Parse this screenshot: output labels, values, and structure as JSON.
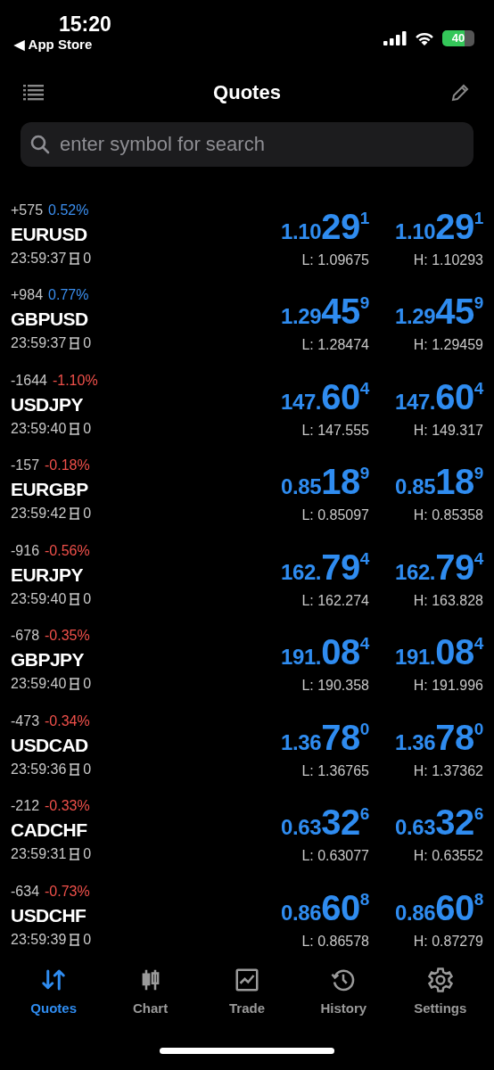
{
  "status_bar": {
    "time": "15:20",
    "back_label": "◀ App Store",
    "battery": "40"
  },
  "header": {
    "title": "Quotes"
  },
  "search": {
    "placeholder": "enter symbol for search"
  },
  "quotes": [
    {
      "change_points": "+575",
      "change_percent": "0.52%",
      "color": "#3b8ff0",
      "symbol": "EURUSD",
      "time": "23:59:37",
      "spread": "0",
      "bid": {
        "prefix": "1.10",
        "big": "29",
        "sup": "1"
      },
      "ask": {
        "prefix": "1.10",
        "big": "29",
        "sup": "1"
      },
      "low": "L: 1.09675",
      "high": "H: 1.10293"
    },
    {
      "change_points": "+984",
      "change_percent": "0.77%",
      "color": "#3b8ff0",
      "symbol": "GBPUSD",
      "time": "23:59:37",
      "spread": "0",
      "bid": {
        "prefix": "1.29",
        "big": "45",
        "sup": "9"
      },
      "ask": {
        "prefix": "1.29",
        "big": "45",
        "sup": "9"
      },
      "low": "L: 1.28474",
      "high": "H: 1.29459"
    },
    {
      "change_points": "-1644",
      "change_percent": "-1.10%",
      "color": "#f0504a",
      "symbol": "USDJPY",
      "time": "23:59:40",
      "spread": "0",
      "bid": {
        "prefix": "147.",
        "big": "60",
        "sup": "4"
      },
      "ask": {
        "prefix": "147.",
        "big": "60",
        "sup": "4"
      },
      "low": "L: 147.555",
      "high": "H: 149.317"
    },
    {
      "change_points": "-157",
      "change_percent": "-0.18%",
      "color": "#f0504a",
      "symbol": "EURGBP",
      "time": "23:59:42",
      "spread": "0",
      "bid": {
        "prefix": "0.85",
        "big": "18",
        "sup": "9"
      },
      "ask": {
        "prefix": "0.85",
        "big": "18",
        "sup": "9"
      },
      "low": "L: 0.85097",
      "high": "H: 0.85358"
    },
    {
      "change_points": "-916",
      "change_percent": "-0.56%",
      "color": "#f0504a",
      "symbol": "EURJPY",
      "time": "23:59:40",
      "spread": "0",
      "bid": {
        "prefix": "162.",
        "big": "79",
        "sup": "4"
      },
      "ask": {
        "prefix": "162.",
        "big": "79",
        "sup": "4"
      },
      "low": "L: 162.274",
      "high": "H: 163.828"
    },
    {
      "change_points": "-678",
      "change_percent": "-0.35%",
      "color": "#f0504a",
      "symbol": "GBPJPY",
      "time": "23:59:40",
      "spread": "0",
      "bid": {
        "prefix": "191.",
        "big": "08",
        "sup": "4"
      },
      "ask": {
        "prefix": "191.",
        "big": "08",
        "sup": "4"
      },
      "low": "L: 190.358",
      "high": "H: 191.996"
    },
    {
      "change_points": "-473",
      "change_percent": "-0.34%",
      "color": "#f0504a",
      "symbol": "USDCAD",
      "time": "23:59:36",
      "spread": "0",
      "bid": {
        "prefix": "1.36",
        "big": "78",
        "sup": "0"
      },
      "ask": {
        "prefix": "1.36",
        "big": "78",
        "sup": "0"
      },
      "low": "L: 1.36765",
      "high": "H: 1.37362"
    },
    {
      "change_points": "-212",
      "change_percent": "-0.33%",
      "color": "#f0504a",
      "symbol": "CADCHF",
      "time": "23:59:31",
      "spread": "0",
      "bid": {
        "prefix": "0.63",
        "big": "32",
        "sup": "6"
      },
      "ask": {
        "prefix": "0.63",
        "big": "32",
        "sup": "6"
      },
      "low": "L: 0.63077",
      "high": "H: 0.63552"
    },
    {
      "change_points": "-634",
      "change_percent": "-0.73%",
      "color": "#f0504a",
      "symbol": "USDCHF",
      "time": "23:59:39",
      "spread": "0",
      "bid": {
        "prefix": "0.86",
        "big": "60",
        "sup": "8"
      },
      "ask": {
        "prefix": "0.86",
        "big": "60",
        "sup": "8"
      },
      "low": "L: 0.86578",
      "high": "H: 0.87279"
    }
  ],
  "tabs": [
    {
      "label": "Quotes",
      "kind": "arrows",
      "selected": true
    },
    {
      "label": "Chart",
      "kind": "candles",
      "selected": false
    },
    {
      "label": "Trade",
      "kind": "trend",
      "selected": false
    },
    {
      "label": "History",
      "kind": "history",
      "selected": false
    },
    {
      "label": "Settings",
      "kind": "gear",
      "selected": false
    }
  ]
}
